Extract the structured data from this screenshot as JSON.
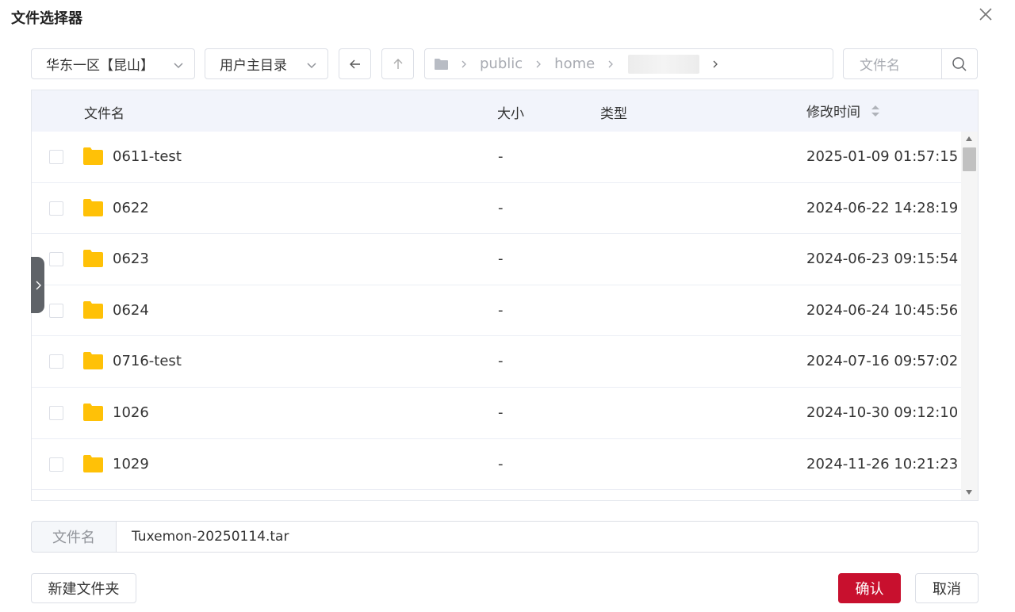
{
  "dialog": {
    "title": "文件选择器"
  },
  "toolbar": {
    "region": "华东一区【昆山】",
    "directory": "用户主目录",
    "path": [
      "public",
      "home"
    ],
    "search_placeholder": "文件名"
  },
  "table": {
    "headers": {
      "name": "文件名",
      "size": "大小",
      "type": "类型",
      "modified": "修改时间"
    },
    "rows": [
      {
        "name": "0611-test",
        "size": "-",
        "type": "",
        "modified": "2025-01-09 01:57:15"
      },
      {
        "name": "0622",
        "size": "-",
        "type": "",
        "modified": "2024-06-22 14:28:19"
      },
      {
        "name": "0623",
        "size": "-",
        "type": "",
        "modified": "2024-06-23 09:15:54"
      },
      {
        "name": "0624",
        "size": "-",
        "type": "",
        "modified": "2024-06-24 10:45:56"
      },
      {
        "name": "0716-test",
        "size": "-",
        "type": "",
        "modified": "2024-07-16 09:57:02"
      },
      {
        "name": "1026",
        "size": "-",
        "type": "",
        "modified": "2024-10-30 09:12:10"
      },
      {
        "name": "1029",
        "size": "-",
        "type": "",
        "modified": "2024-11-26 10:21:23"
      }
    ]
  },
  "filename": {
    "label": "文件名",
    "value": "Tuxemon-20250114.tar"
  },
  "buttons": {
    "new_folder": "新建文件夹",
    "confirm": "确认",
    "cancel": "取消"
  },
  "colors": {
    "primary": "#c8102e",
    "folder": "#ffc107",
    "header_bg": "#f2f4fb"
  }
}
